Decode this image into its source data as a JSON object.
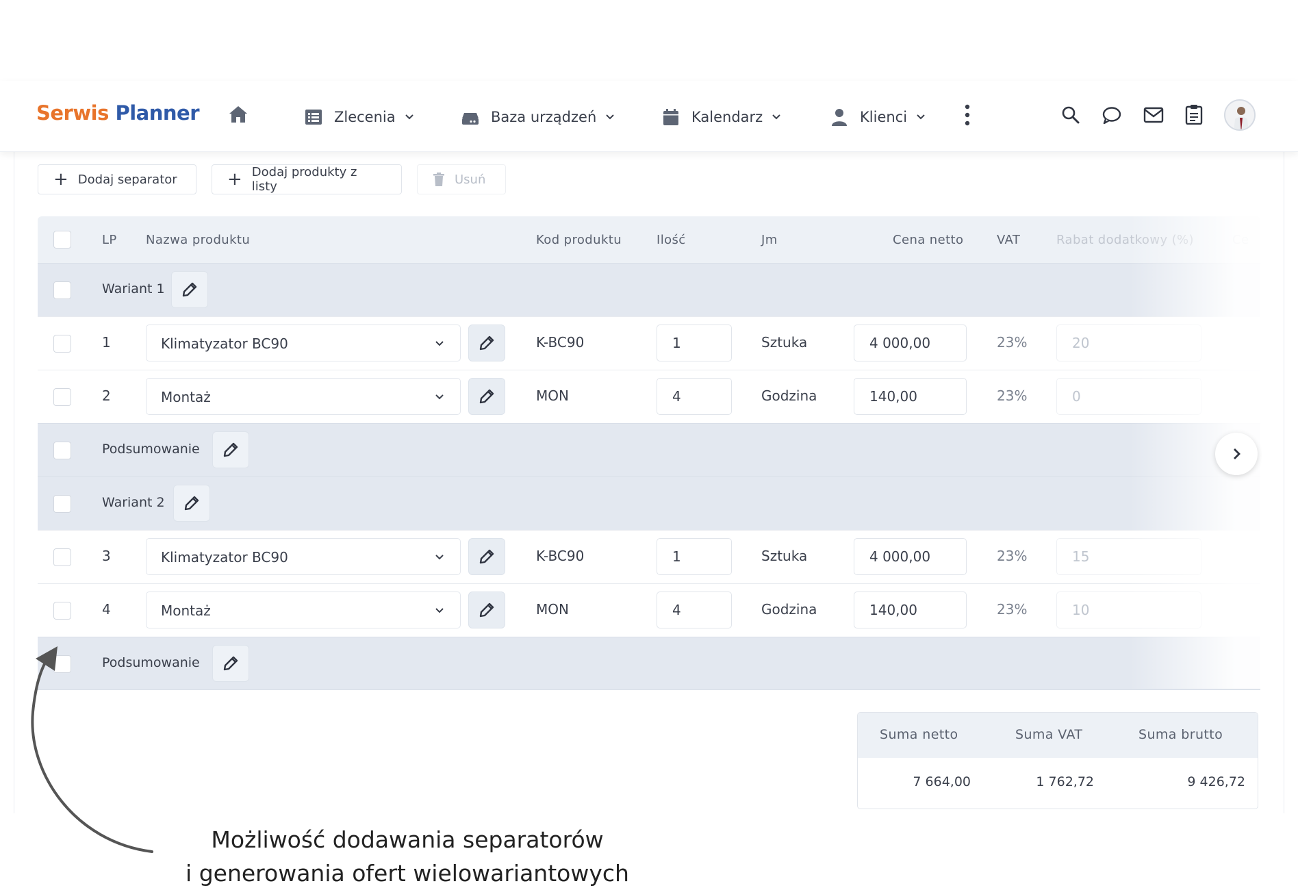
{
  "navbar": {
    "logo_part1": "Serwis",
    "logo_part2": "Planner",
    "items": [
      {
        "label": "Zlecenia",
        "icon": "list-icon"
      },
      {
        "label": "Baza urządzeń",
        "icon": "device-icon"
      },
      {
        "label": "Kalendarz",
        "icon": "calendar-icon"
      },
      {
        "label": "Klienci",
        "icon": "user-icon"
      }
    ],
    "right_icons": [
      "search-icon",
      "chat-icon",
      "mail-icon",
      "clipboard-icon",
      "avatar"
    ]
  },
  "toolbar": {
    "add_separator": "Dodaj separator",
    "add_products": "Dodaj produkty z listy",
    "delete": "Usuń"
  },
  "table": {
    "headers": {
      "lp": "LP",
      "name": "Nazwa produktu",
      "code": "Kod produktu",
      "qty": "Ilość",
      "unit": "Jm",
      "price": "Cena netto",
      "vat": "VAT",
      "discount": "Rabat dodatkowy (%)",
      "next": "Ce"
    },
    "separators": {
      "s1": "Wariant 1",
      "s2": "Podsumowanie",
      "s3": "Wariant 2",
      "s4": "Podsumowanie"
    },
    "rows": [
      {
        "lp": "1",
        "name": "Klimatyzator BC90",
        "code": "K-BC90",
        "qty": "1",
        "unit": "Sztuka",
        "price": "4 000,00",
        "vat": "23%",
        "discount": "20"
      },
      {
        "lp": "2",
        "name": "Montaż",
        "code": "MON",
        "qty": "4",
        "unit": "Godzina",
        "price": "140,00",
        "vat": "23%",
        "discount": "0"
      },
      {
        "lp": "3",
        "name": "Klimatyzator BC90",
        "code": "K-BC90",
        "qty": "1",
        "unit": "Sztuka",
        "price": "4 000,00",
        "vat": "23%",
        "discount": "15"
      },
      {
        "lp": "4",
        "name": "Montaż",
        "code": "MON",
        "qty": "4",
        "unit": "Godzina",
        "price": "140,00",
        "vat": "23%",
        "discount": "10"
      }
    ]
  },
  "summary": {
    "net_label": "Suma netto",
    "vat_label": "Suma VAT",
    "gross_label": "Suma brutto",
    "net_value": "7 664,00",
    "vat_value": "1 762,72",
    "gross_value": "9 426,72"
  },
  "caption": {
    "line1": "Możliwość dodawania separatorów",
    "line2": "i generowania ofert wielowariantowych"
  },
  "colors": {
    "logo_orange": "#e8742b",
    "logo_blue": "#2f5aa8",
    "header_bg": "#edf1f6",
    "separator_bg": "#e3e8f0"
  }
}
